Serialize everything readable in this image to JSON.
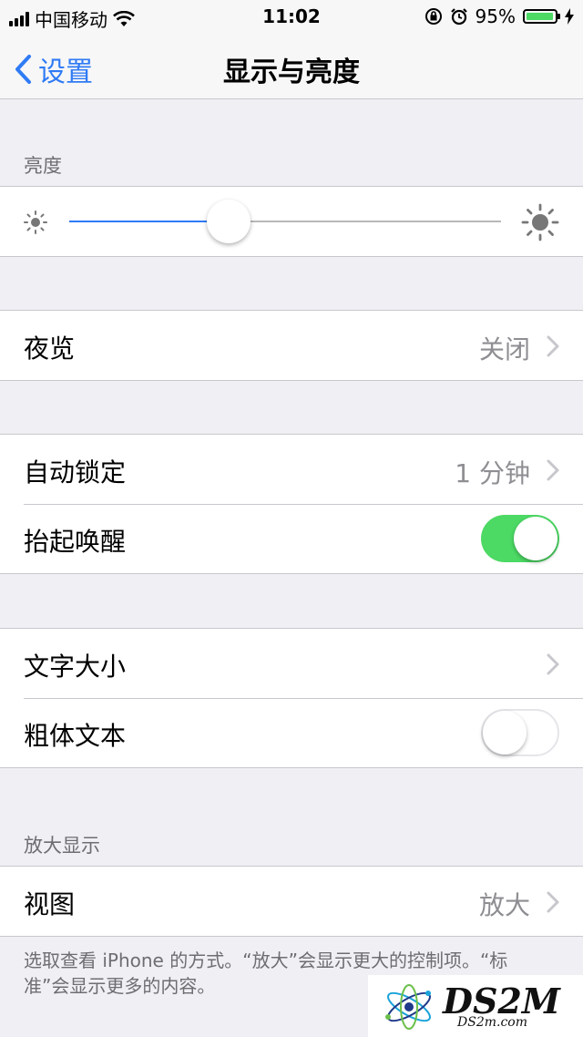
{
  "status": {
    "carrier": "中国移动",
    "time": "11:02",
    "battery_text": "95%",
    "battery_level": 0.95
  },
  "nav": {
    "back_label": "设置",
    "title": "显示与亮度"
  },
  "brightness": {
    "header": "亮度",
    "level": 0.37
  },
  "night_shift": {
    "label": "夜览",
    "value": "关闭"
  },
  "auto_lock": {
    "label": "自动锁定",
    "value": "1 分钟"
  },
  "raise_to_wake": {
    "label": "抬起唤醒",
    "on": true
  },
  "text_size": {
    "label": "文字大小"
  },
  "bold_text": {
    "label": "粗体文本",
    "on": false
  },
  "zoom": {
    "header": "放大显示",
    "view_label": "视图",
    "view_value": "放大",
    "footer": "选取查看 iPhone 的方式。“放大”会显示更大的控制项。“标准”会显示更多的内容。"
  },
  "watermark": {
    "logo": "DS2M",
    "sub": "DS2m.com"
  },
  "colors": {
    "accent": "#2f7bf5",
    "switch_on": "#4cd964",
    "background": "#efeff4"
  }
}
